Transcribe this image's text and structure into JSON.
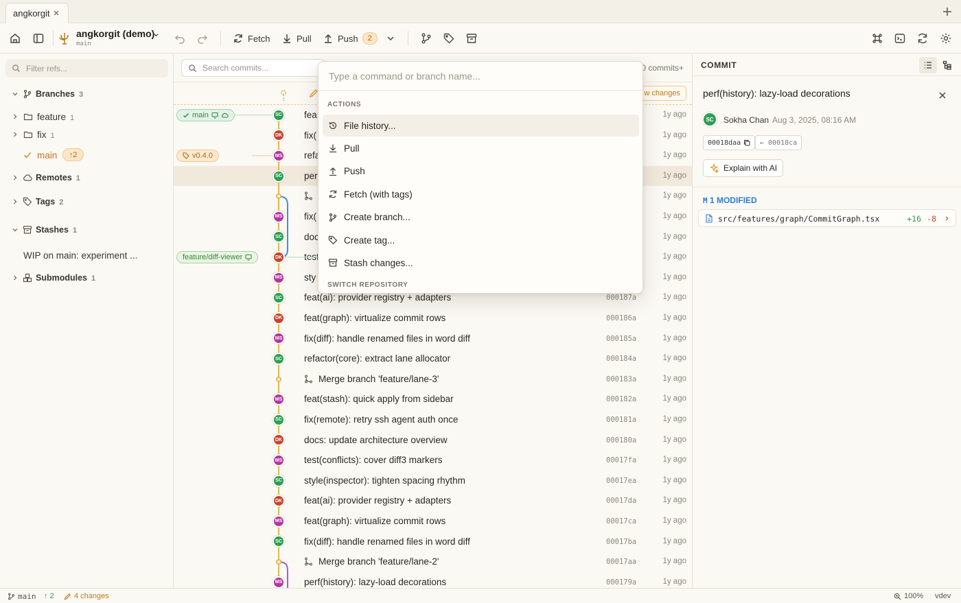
{
  "tab": {
    "label": "angkorgit"
  },
  "toolbar": {
    "repo_name": "angkorgit (demo)",
    "repo_branch": "main",
    "fetch_label": "Fetch",
    "pull_label": "Pull",
    "push_label": "Push",
    "push_count": "2"
  },
  "sidebar": {
    "filter_placeholder": "Filter refs...",
    "branches_label": "Branches",
    "branches_count": "3",
    "feature_label": "feature",
    "feature_count": "1",
    "fix_label": "fix",
    "fix_count": "1",
    "main_label": "main",
    "main_ahead": "↑2",
    "remotes_label": "Remotes",
    "remotes_count": "1",
    "tags_label": "Tags",
    "tags_count": "2",
    "stashes_label": "Stashes",
    "stashes_count": "1",
    "stash_item": "WIP on main: experiment ...",
    "submodules_label": "Submodules",
    "submodules_count": "1"
  },
  "center": {
    "search_placeholder": "Search commits...",
    "commits_count": "0 commits+",
    "view_changes": "w changes",
    "badges": {
      "main": "main",
      "tag": "v0.4.0",
      "feature": "feature/diff-viewer"
    },
    "commits": [
      {
        "msg": "fea",
        "sha": "",
        "time": "1y ago",
        "author": "SC"
      },
      {
        "msg": "fix(",
        "sha": "",
        "time": "1y ago",
        "author": "DK"
      },
      {
        "msg": "refa",
        "sha": "",
        "time": "1y ago",
        "author": "MS"
      },
      {
        "msg": "per",
        "sha": "",
        "time": "1y ago",
        "author": "SC"
      },
      {
        "msg": "",
        "sha": "",
        "time": "1y ago",
        "author": ""
      },
      {
        "msg": "fix(",
        "sha": "",
        "time": "1y ago",
        "author": "MS"
      },
      {
        "msg": "doc",
        "sha": "",
        "time": "1y ago",
        "author": "SC"
      },
      {
        "msg": "test",
        "sha": "",
        "time": "1y ago",
        "author": "DK"
      },
      {
        "msg": "sty",
        "sha": "",
        "time": "1y ago",
        "author": "MS"
      },
      {
        "msg": "feat(ai): provider registry + adapters",
        "sha": "000187a",
        "time": "1y ago",
        "author": "SC"
      },
      {
        "msg": "feat(graph): virtualize commit rows",
        "sha": "000186a",
        "time": "1y ago",
        "author": "DK"
      },
      {
        "msg": "fix(diff): handle renamed files in word diff",
        "sha": "000185a",
        "time": "1y ago",
        "author": "MS"
      },
      {
        "msg": "refactor(core): extract lane allocator",
        "sha": "000184a",
        "time": "1y ago",
        "author": "SC"
      },
      {
        "msg": "Merge branch 'feature/lane-3'",
        "sha": "000183a",
        "time": "1y ago",
        "author": ""
      },
      {
        "msg": "feat(stash): quick apply from sidebar",
        "sha": "000182a",
        "time": "1y ago",
        "author": "MS"
      },
      {
        "msg": "fix(remote): retry ssh agent auth once",
        "sha": "000181a",
        "time": "1y ago",
        "author": "SC"
      },
      {
        "msg": "docs: update architecture overview",
        "sha": "000180a",
        "time": "1y ago",
        "author": "DK"
      },
      {
        "msg": "test(conflicts): cover diff3 markers",
        "sha": "00017fa",
        "time": "1y ago",
        "author": "MS"
      },
      {
        "msg": "style(inspector): tighten spacing rhythm",
        "sha": "00017ea",
        "time": "1y ago",
        "author": "SC"
      },
      {
        "msg": "feat(ai): provider registry + adapters",
        "sha": "00017da",
        "time": "1y ago",
        "author": "DK"
      },
      {
        "msg": "feat(graph): virtualize commit rows",
        "sha": "00017ca",
        "time": "1y ago",
        "author": "MS"
      },
      {
        "msg": "fix(diff): handle renamed files in word diff",
        "sha": "00017ba",
        "time": "1y ago",
        "author": "SC"
      },
      {
        "msg": "Merge branch 'feature/lane-2'",
        "sha": "00017aa",
        "time": "1y ago",
        "author": ""
      },
      {
        "msg": "perf(history): lazy-load decorations",
        "sha": "000179a",
        "time": "1y ago",
        "author": "MS"
      }
    ]
  },
  "palette": {
    "placeholder": "Type a command or branch name...",
    "actions_label": "ACTIONS",
    "items": [
      "File history...",
      "Pull",
      "Push",
      "Fetch (with tags)",
      "Create branch...",
      "Create tag...",
      "Stash changes..."
    ],
    "switch_label": "SWITCH REPOSITORY"
  },
  "inspector": {
    "heading": "COMMIT",
    "title": "perf(history): lazy-load decorations",
    "author_initials": "SC",
    "author_name": "Sokha Chan",
    "date": "Aug 3, 2025, 08:16 AM",
    "sha": "00018daa",
    "parent_sha": "← 00018ca",
    "explain_label": "Explain with AI",
    "modified_label": "1 MODIFIED",
    "modified_marker": "M",
    "file_path": "src/features/graph/CommitGraph.tsx",
    "additions": "+16",
    "deletions": "-8"
  },
  "statusbar": {
    "branch": "main",
    "ahead": "↑ 2",
    "changes": "4 changes",
    "zoom": "100%",
    "env": "vdev"
  },
  "colors": {
    "SC": "#2f9e55",
    "DK": "#c2452f",
    "MS": "#b0389e",
    "accent": "#e39a2f"
  }
}
